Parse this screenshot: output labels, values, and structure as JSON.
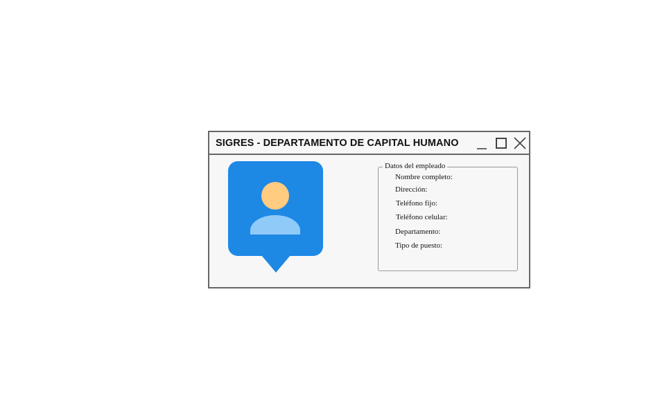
{
  "window": {
    "title": "SIGRES - DEPARTAMENTO DE CAPITAL HUMANO",
    "controls": {
      "minimize": "minimize-icon",
      "maximize": "maximize-icon",
      "close": "close-icon"
    }
  },
  "avatar": {
    "icon": "user-location-icon",
    "colors": {
      "badge": "#1e88e5",
      "head": "#ffcc80",
      "body": "#90caf9"
    }
  },
  "employee_data": {
    "legend": "Datos del empleado",
    "fields": [
      {
        "label": "Nombre completo:"
      },
      {
        "label": "Dirección:"
      },
      {
        "label": "Teléfono fijo:"
      },
      {
        "label": "Teléfono celular:"
      },
      {
        "label": "Departamento:"
      },
      {
        "label": "Tipo de puesto:"
      }
    ]
  }
}
